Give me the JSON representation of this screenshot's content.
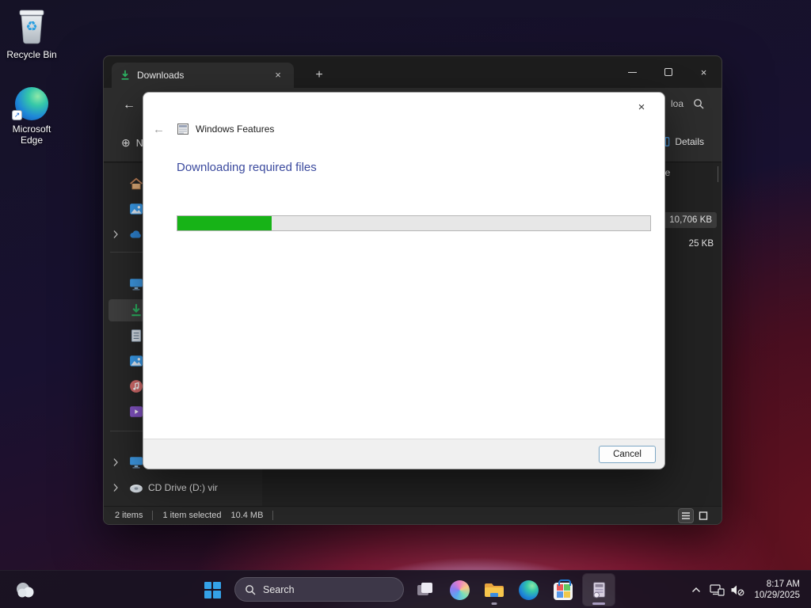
{
  "desktop": {
    "icons": [
      {
        "label": "Recycle Bin"
      },
      {
        "label": "Microsoft Edge"
      }
    ]
  },
  "explorer": {
    "tab_title": "Downloads",
    "toolbar": {
      "new_label": "New",
      "details_label": "Details"
    },
    "search_visible_text": "loa",
    "size_column_header": "Size",
    "files": [
      {
        "size": "10,706 KB"
      },
      {
        "size": "25 KB"
      }
    ],
    "sidebar": {
      "cd_drive_label": "CD Drive (D:) vir"
    },
    "statusbar": {
      "items_count": "2 items",
      "selected_count": "1 item selected",
      "selected_size": "10.4 MB"
    }
  },
  "dialog": {
    "title": "Windows Features",
    "heading": "Downloading required files",
    "progress_percent": 20,
    "cancel_label": "Cancel"
  },
  "taskbar": {
    "search_placeholder": "Search",
    "clock_time": "8:17 AM",
    "clock_date": "10/29/2025"
  },
  "icons": {
    "close_glyph": "×",
    "plus_glyph": "+",
    "back_glyph": "←",
    "new_circle_glyph": "⊕",
    "recycle_glyph": "♻",
    "shortcut_glyph": "↗"
  },
  "colors": {
    "accent_green": "#17b317",
    "heading_blue": "#3b4a9e"
  }
}
